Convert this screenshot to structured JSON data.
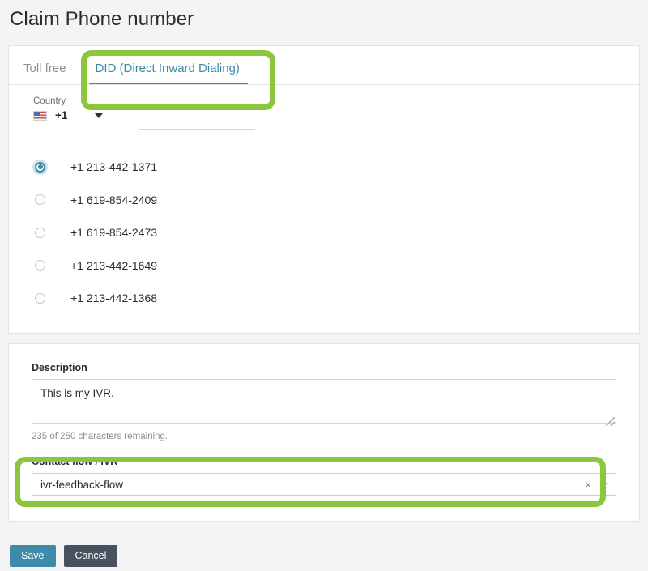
{
  "page": {
    "title": "Claim Phone number"
  },
  "tabs": [
    {
      "label": "Toll free",
      "active": false
    },
    {
      "label": "DID (Direct Inward Dialing)",
      "active": true
    }
  ],
  "country_field": {
    "label": "Country",
    "flag_icon": "us-flag-icon",
    "code": "+1",
    "caret_icon": "chevron-down-icon"
  },
  "prefix_field": {
    "value": "",
    "placeholder": ""
  },
  "numbers": {
    "selected_index": 0,
    "items": [
      {
        "label": "+1 213-442-1371"
      },
      {
        "label": "+1 619-854-2409"
      },
      {
        "label": "+1 619-854-2473"
      },
      {
        "label": "+1 213-442-1649"
      },
      {
        "label": "+1 213-442-1368"
      }
    ]
  },
  "description": {
    "label": "Description",
    "value": "This is my IVR.",
    "placeholder": "",
    "helper": "235 of 250 characters remaining."
  },
  "contact_flow": {
    "label": "Contact flow / IVR",
    "value": "ivr-feedback-flow",
    "clear_icon": "×",
    "caret_icon": "chevron-down-icon"
  },
  "footer": {
    "save_label": "Save",
    "cancel_label": "Cancel"
  },
  "colors": {
    "accent": "#3d8ba8",
    "annotation": "#8cc63e",
    "cancel": "#48525e",
    "page_bg": "#f4f4f4"
  }
}
